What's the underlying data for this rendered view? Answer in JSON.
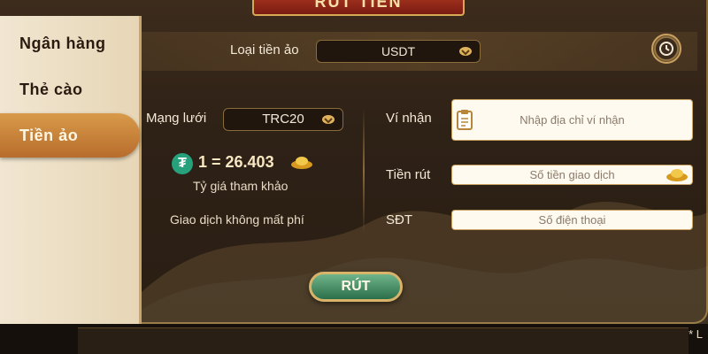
{
  "banner": {
    "title": "RÚT TIỀN"
  },
  "sidebar": {
    "items": [
      {
        "label": "Ngân hàng"
      },
      {
        "label": "Thẻ cào"
      },
      {
        "label": "Tiền ảo"
      }
    ]
  },
  "top": {
    "currency_label": "Loại tiền ảo",
    "currency_value": "USDT"
  },
  "network": {
    "label": "Mạng lưới",
    "value": "TRC20"
  },
  "rate": {
    "text": "1 = 26.403",
    "caption": "Tỷ giá tham khảo",
    "fee_note": "Giao dịch không mất phí"
  },
  "form": {
    "wallet_label": "Ví nhận",
    "wallet_placeholder": "Nhập địa chỉ ví nhận",
    "amount_label": "Tiền rút",
    "amount_placeholder": "Số tiền giao dịch",
    "phone_label": "SĐT",
    "phone_placeholder": "Số điện thoại"
  },
  "submit": {
    "label": "RÚT"
  },
  "underlay": {
    "note": "* L"
  },
  "icons": {
    "history": "history-clock-icon",
    "tether": "tether-icon",
    "paste": "clipboard-icon",
    "gold": "gold-ingot-icon"
  }
}
